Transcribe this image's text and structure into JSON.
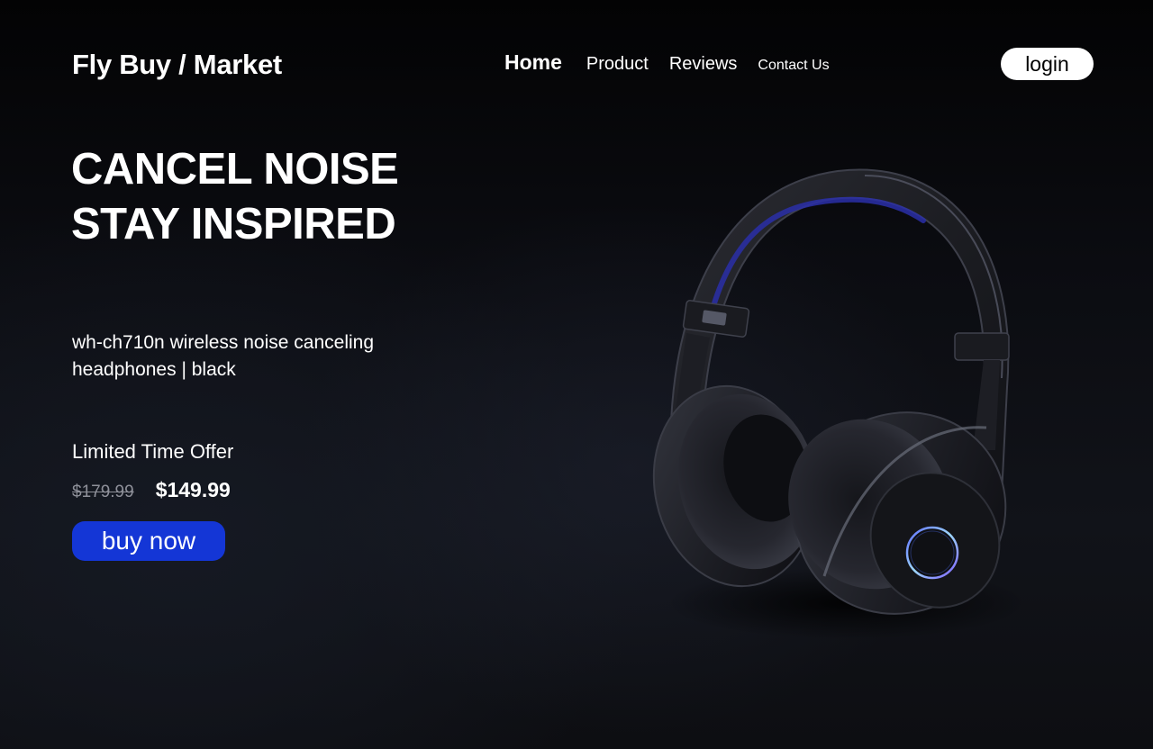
{
  "header": {
    "logo": "Fly Buy / Market",
    "nav": {
      "home": "Home",
      "product": "Product",
      "reviews": "Reviews",
      "contact": "Contact Us"
    },
    "login_label": "login"
  },
  "hero": {
    "headline_line1": "CANCEL NOISE",
    "headline_line2": "STAY INSPIRED",
    "product_description": "wh-ch710n wireless noise canceling headphones | black",
    "offer_label": "Limited Time Offer",
    "old_price": "$179.99",
    "new_price": "$149.99",
    "buy_label": "buy now",
    "product_image_icon": "headphones-image"
  },
  "colors": {
    "background": "#0b0c11",
    "accent": "#1436d6",
    "text": "#ffffff",
    "muted_price": "#8e9099"
  }
}
